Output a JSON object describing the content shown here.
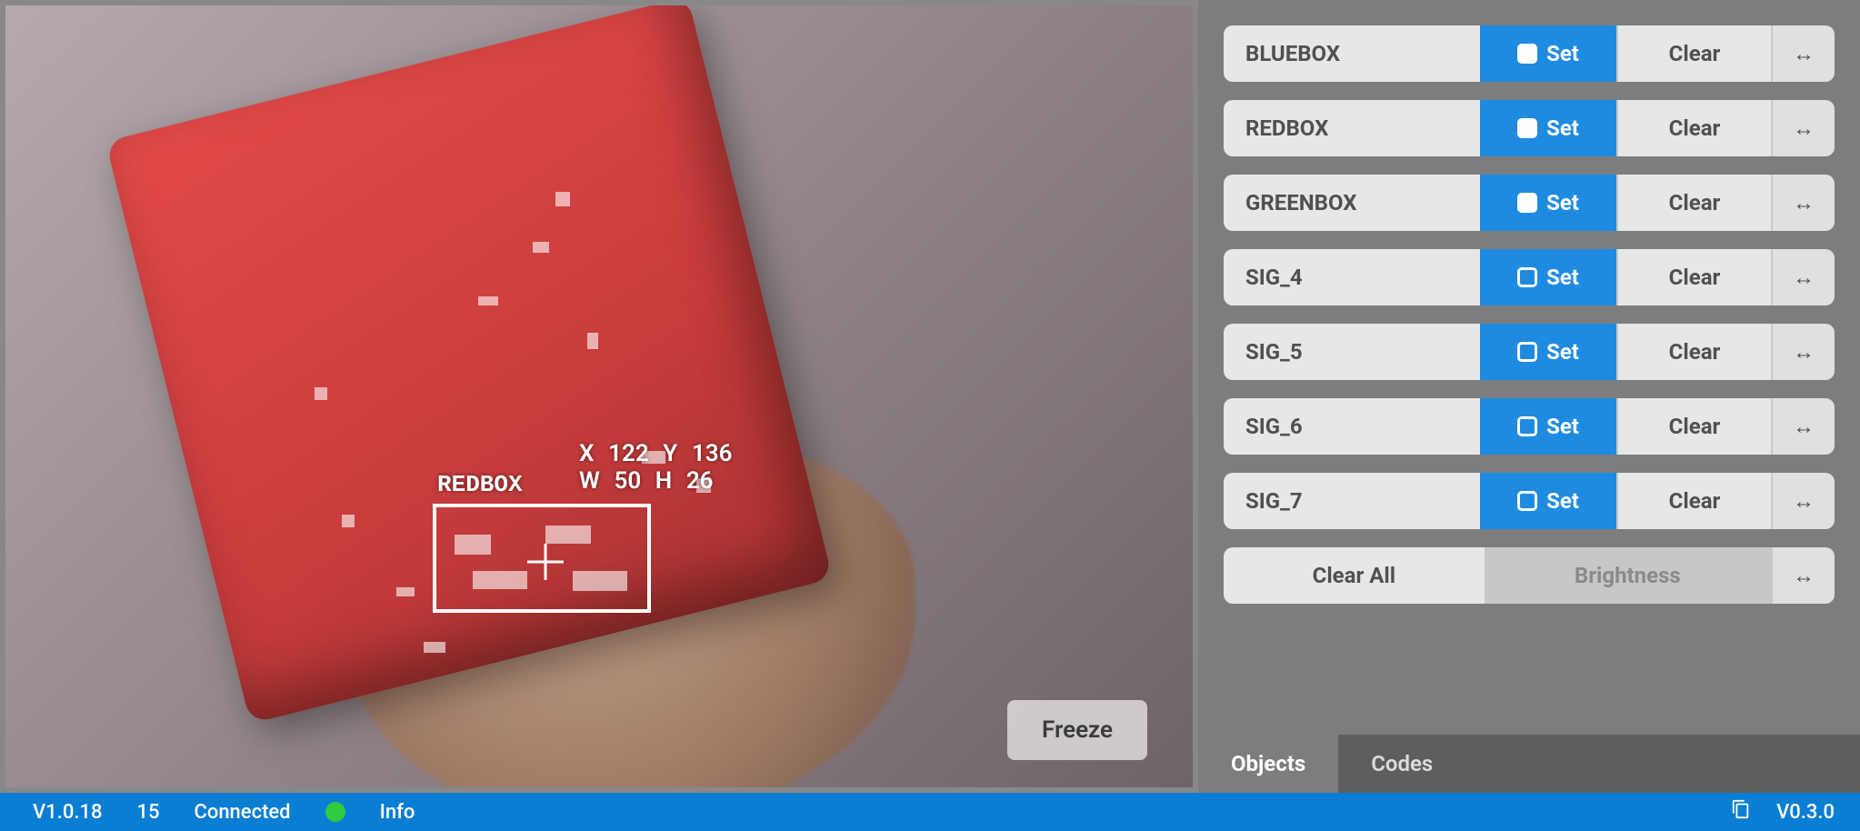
{
  "video": {
    "overlay": {
      "x_label": "X",
      "x_value": "122",
      "y_label": "Y",
      "y_value": "136",
      "w_label": "W",
      "w_value": "50",
      "h_label": "H",
      "h_value": "26",
      "detected_name": "REDBOX"
    },
    "freeze_label": "Freeze"
  },
  "signatures": [
    {
      "name": "BLUEBOX",
      "set_label": "Set",
      "clear_label": "Clear",
      "checked": true
    },
    {
      "name": "REDBOX",
      "set_label": "Set",
      "clear_label": "Clear",
      "checked": true
    },
    {
      "name": "GREENBOX",
      "set_label": "Set",
      "clear_label": "Clear",
      "checked": true
    },
    {
      "name": "SIG_4",
      "set_label": "Set",
      "clear_label": "Clear",
      "checked": false
    },
    {
      "name": "SIG_5",
      "set_label": "Set",
      "clear_label": "Clear",
      "checked": false
    },
    {
      "name": "SIG_6",
      "set_label": "Set",
      "clear_label": "Clear",
      "checked": false
    },
    {
      "name": "SIG_7",
      "set_label": "Set",
      "clear_label": "Clear",
      "checked": false
    }
  ],
  "extra": {
    "clear_all_label": "Clear All",
    "brightness_label": "Brightness"
  },
  "tabs": {
    "objects": "Objects",
    "codes": "Codes",
    "active": "objects"
  },
  "status": {
    "firmware_version": "V1.0.18",
    "counter": "15",
    "connection": "Connected",
    "info_label": "Info",
    "app_version": "V0.3.0"
  },
  "icons": {
    "arrow_h": "↔",
    "copy": "copy-icon"
  }
}
